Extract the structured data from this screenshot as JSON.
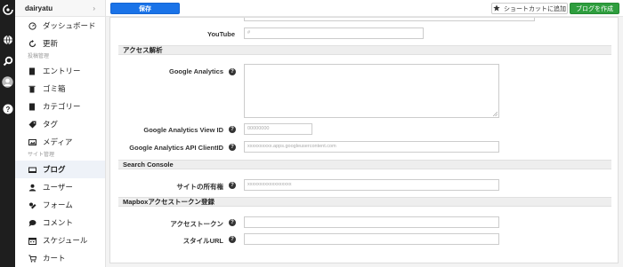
{
  "rail": {
    "icons": [
      "logo-icon",
      "globe-icon",
      "search-icon",
      "user-avatar",
      "help-icon"
    ]
  },
  "sidebar": {
    "blog_name": "dairyatu",
    "header_chevron": "›",
    "items_top": [
      {
        "label": "ダッシュボード",
        "icon": "dashboard-icon"
      },
      {
        "label": "更新",
        "icon": "refresh-icon"
      }
    ],
    "section_content": "投稿管理",
    "items_content": [
      {
        "label": "エントリー",
        "icon": "entry-icon"
      },
      {
        "label": "ゴミ箱",
        "icon": "trash-icon"
      },
      {
        "label": "カテゴリー",
        "icon": "category-icon"
      },
      {
        "label": "タグ",
        "icon": "tag-icon"
      },
      {
        "label": "メディア",
        "icon": "media-icon"
      }
    ],
    "section_site": "サイト管理",
    "items_site": [
      {
        "label": "ブログ",
        "icon": "blog-icon",
        "active": true
      },
      {
        "label": "ユーザー",
        "icon": "user-icon"
      },
      {
        "label": "フォーム",
        "icon": "form-icon"
      },
      {
        "label": "コメント",
        "icon": "comment-icon"
      },
      {
        "label": "スケジュール",
        "icon": "schedule-icon"
      },
      {
        "label": "カート",
        "icon": "cart-icon"
      }
    ]
  },
  "toolbar": {
    "save_label": "保存",
    "shortcut_label": "ショートカットに追加",
    "create_label": "ブログを作成"
  },
  "form": {
    "youtube": {
      "label": "YouTube",
      "placeholder": "#"
    },
    "access_section": "アクセス解析",
    "ga": {
      "label": "Google Analytics"
    },
    "ga_view": {
      "label": "Google Analytics View ID",
      "placeholder": "00000000"
    },
    "ga_client": {
      "label": "Google Analytics API ClientID",
      "placeholder": "xxxxxxxxxx.apps.googleusercontent.com"
    },
    "search_section": "Search Console",
    "site_owner": {
      "label": "サイトの所有権",
      "placeholder": "xxxxxxxxxxxxxxxxxx"
    },
    "mapbox_section": "Mapboxアクセストークン登録",
    "access_token": {
      "label": "アクセストークン",
      "placeholder": ""
    },
    "style_url": {
      "label": "スタイルURL",
      "placeholder": ""
    }
  },
  "colors": {
    "save": "#1a73e8",
    "create": "#2e9e3e",
    "rail": "#1e1e1e"
  }
}
